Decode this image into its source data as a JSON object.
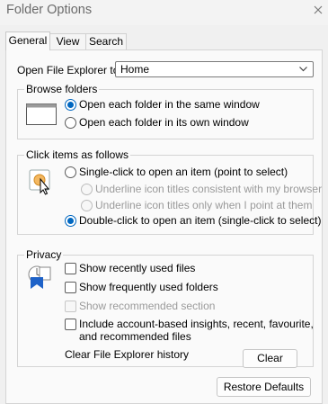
{
  "window": {
    "title": "Folder Options"
  },
  "tabs": [
    {
      "label": "General",
      "active": true
    },
    {
      "label": "View",
      "active": false
    },
    {
      "label": "Search",
      "active": false
    }
  ],
  "open_explorer": {
    "label": "Open File Explorer to:",
    "selected": "Home"
  },
  "browse_folders": {
    "title": "Browse folders",
    "options": [
      {
        "label": "Open each folder in the same window",
        "selected": true
      },
      {
        "label": "Open each folder in its own window",
        "selected": false
      }
    ]
  },
  "click_items": {
    "title": "Click items as follows",
    "single": {
      "label": "Single-click to open an item (point to select)",
      "selected": false
    },
    "sub_options": [
      {
        "label": "Underline icon titles consistent with my browser",
        "enabled": false
      },
      {
        "label": "Underline icon titles only when I point at them",
        "enabled": false
      }
    ],
    "double": {
      "label": "Double-click to open an item (single-click to select)",
      "selected": true
    }
  },
  "privacy": {
    "title": "Privacy",
    "checks": [
      {
        "label": "Show recently used files",
        "checked": false,
        "enabled": true
      },
      {
        "label": "Show frequently used folders",
        "checked": false,
        "enabled": true
      },
      {
        "label": "Show recommended section",
        "checked": false,
        "enabled": false
      }
    ],
    "insights_line1": "Include account-based insights, recent, favourite,",
    "insights_line2": "and recommended files",
    "clear_history_label": "Clear File Explorer history",
    "clear_button": "Clear"
  },
  "restore_defaults": "Restore Defaults",
  "colors": {
    "accent": "#0067c0",
    "panel": "#fafafa",
    "window": "#f0f0f0"
  }
}
